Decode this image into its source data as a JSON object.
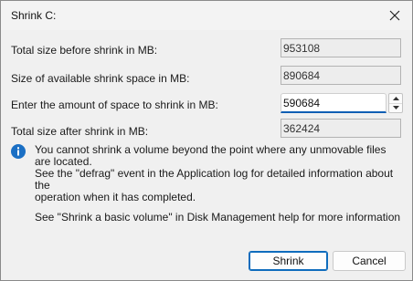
{
  "window": {
    "title": "Shrink C:"
  },
  "rows": {
    "total_before_label": "Total size before shrink in MB:",
    "total_before_value": "953108",
    "available_label": "Size of available shrink space in MB:",
    "available_value": "890684",
    "amount_label": "Enter the amount of space to shrink in MB:",
    "amount_value": "590684",
    "total_after_label": "Total size after shrink in MB:",
    "total_after_value": "362424"
  },
  "info": {
    "icon": "info-icon",
    "line1": "You cannot shrink a volume beyond the point where any unmovable files are located.",
    "line2": "See the \"defrag\" event in the Application log for detailed information about the",
    "line3": "operation when it has completed."
  },
  "help": {
    "text": "See \"Shrink a basic volume\" in Disk Management help for more information"
  },
  "buttons": {
    "shrink": "Shrink",
    "cancel": "Cancel"
  },
  "colors": {
    "accent": "#0f6cbd",
    "info_icon": "#1a6fc4"
  }
}
